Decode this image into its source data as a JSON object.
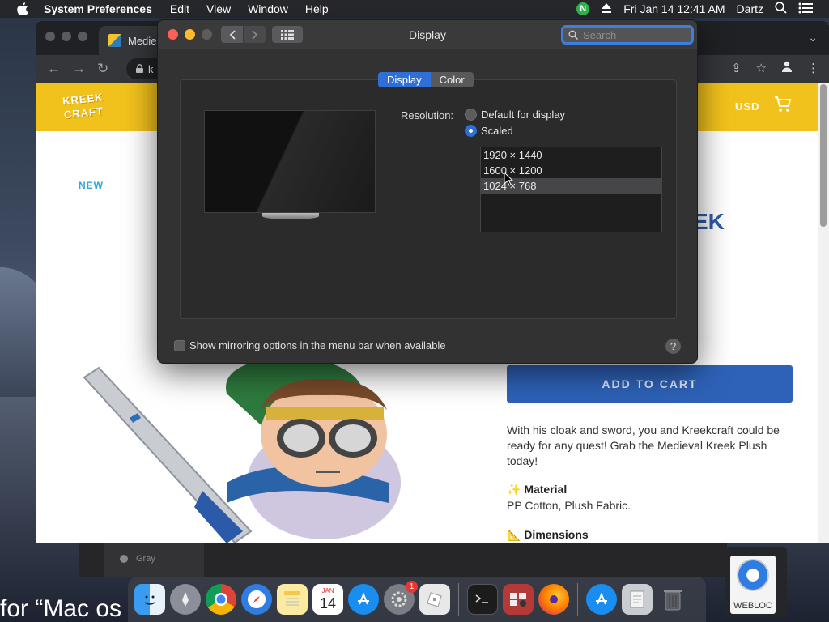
{
  "menubar": {
    "app_name": "System Preferences",
    "items": [
      "Edit",
      "View",
      "Window",
      "Help"
    ],
    "status_n": "N",
    "datetime": "Fri Jan 14  12:41 AM",
    "user": "Dartz"
  },
  "browser": {
    "tab_title": "Medie",
    "omnibox_text": "k"
  },
  "site": {
    "logo": "KREEK CRAFT",
    "currency": "USD",
    "new_badge": "NEW",
    "title_fragment": "EK",
    "add_to_cart": "ADD TO CART",
    "description": "With his cloak and sword, you and Kreekcraft could be ready for any quest! Grab the Medieval Kreek Plush today!",
    "material_label": "✨ Material",
    "material_value": "PP Cotton, Plush Fabric.",
    "dimensions_label": "📐 Dimensions"
  },
  "back_app": {
    "gray_label": "Gray"
  },
  "search_caption": "for “Mac os",
  "prefs": {
    "window_title": "Display",
    "search_placeholder": "Search",
    "tabs": [
      "Display",
      "Color"
    ],
    "active_tab": "Display",
    "resolution_label": "Resolution:",
    "options": [
      "Default for display",
      "Scaled"
    ],
    "selected_option": "Scaled",
    "resolutions": [
      "1920 × 1440",
      "1600 × 1200",
      "1024 × 768"
    ],
    "selected_resolution": "1024 × 768",
    "mirror_label": "Show mirroring options in the menu bar when available",
    "help": "?"
  },
  "dock": {
    "calendar_month": "JAN",
    "calendar_day": "14",
    "prefs_badge": "1"
  },
  "webloc_label": "WEBLOC",
  "colors": {
    "site_yellow": "#f2c21c",
    "cart_blue": "#2e62b8",
    "accent_blue": "#2f6fd8"
  }
}
